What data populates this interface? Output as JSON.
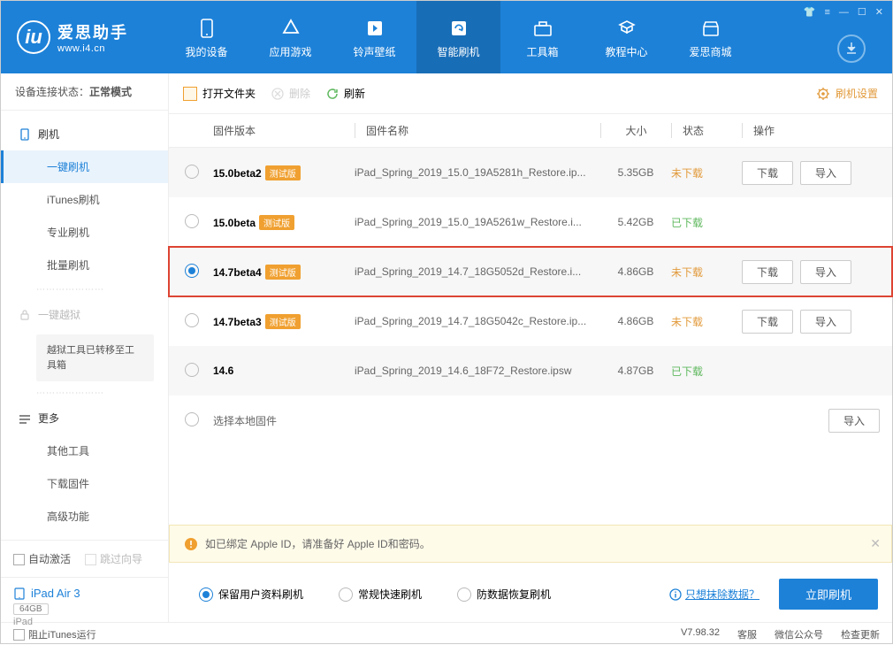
{
  "header": {
    "brand_cn": "爱思助手",
    "brand_en": "www.i4.cn",
    "nav": [
      {
        "id": "device",
        "label": "我的设备"
      },
      {
        "id": "apps",
        "label": "应用游戏"
      },
      {
        "id": "ringtone",
        "label": "铃声壁纸"
      },
      {
        "id": "flash",
        "label": "智能刷机"
      },
      {
        "id": "toolbox",
        "label": "工具箱"
      },
      {
        "id": "tutorial",
        "label": "教程中心"
      },
      {
        "id": "shop",
        "label": "爱思商城"
      }
    ]
  },
  "sidebar": {
    "device_status_label": "设备连接状态：",
    "device_status_value": "正常模式",
    "flash_group": "刷机",
    "items": [
      {
        "label": "一键刷机"
      },
      {
        "label": "iTunes刷机"
      },
      {
        "label": "专业刷机"
      },
      {
        "label": "批量刷机"
      }
    ],
    "jailbreak_group": "一键越狱",
    "jailbreak_note": "越狱工具已转移至工具箱",
    "more_group": "更多",
    "more_items": [
      {
        "label": "其他工具"
      },
      {
        "label": "下载固件"
      },
      {
        "label": "高级功能"
      }
    ],
    "auto_activate": "自动激活",
    "skip_guide": "跳过向导",
    "device_name": "iPad Air 3",
    "device_storage": "64GB",
    "device_type": "iPad"
  },
  "toolbar": {
    "open_folder": "打开文件夹",
    "delete": "删除",
    "refresh": "刷新",
    "settings": "刷机设置"
  },
  "table": {
    "headers": {
      "version": "固件版本",
      "name": "固件名称",
      "size": "大小",
      "status": "状态",
      "action": "操作"
    },
    "beta_tag": "测试版",
    "download_btn": "下载",
    "import_btn": "导入",
    "rows": [
      {
        "version": "15.0beta2",
        "beta": true,
        "name": "iPad_Spring_2019_15.0_19A5281h_Restore.ip...",
        "size": "5.35GB",
        "status": "未下载",
        "status_ok": false,
        "checked": false,
        "buttons": true
      },
      {
        "version": "15.0beta",
        "beta": true,
        "name": "iPad_Spring_2019_15.0_19A5261w_Restore.i...",
        "size": "5.42GB",
        "status": "已下载",
        "status_ok": true,
        "checked": false,
        "buttons": false
      },
      {
        "version": "14.7beta4",
        "beta": true,
        "name": "iPad_Spring_2019_14.7_18G5052d_Restore.i...",
        "size": "4.86GB",
        "status": "未下载",
        "status_ok": false,
        "checked": true,
        "buttons": true,
        "highlight": true
      },
      {
        "version": "14.7beta3",
        "beta": true,
        "name": "iPad_Spring_2019_14.7_18G5042c_Restore.ip...",
        "size": "4.86GB",
        "status": "未下载",
        "status_ok": false,
        "checked": false,
        "buttons": true
      },
      {
        "version": "14.6",
        "beta": false,
        "name": "iPad_Spring_2019_14.6_18F72_Restore.ipsw",
        "size": "4.87GB",
        "status": "已下载",
        "status_ok": true,
        "checked": false,
        "buttons": false
      }
    ],
    "local_firmware": "选择本地固件"
  },
  "warning": "如已绑定 Apple ID，请准备好 Apple ID和密码。",
  "options": {
    "o1": "保留用户资料刷机",
    "o2": "常规快速刷机",
    "o3": "防数据恢复刷机",
    "erase": "只想抹除数据？",
    "flash_now": "立即刷机"
  },
  "footer": {
    "block_itunes": "阻止iTunes运行",
    "version": "V7.98.32",
    "service": "客服",
    "wechat": "微信公众号",
    "check_update": "检查更新"
  }
}
